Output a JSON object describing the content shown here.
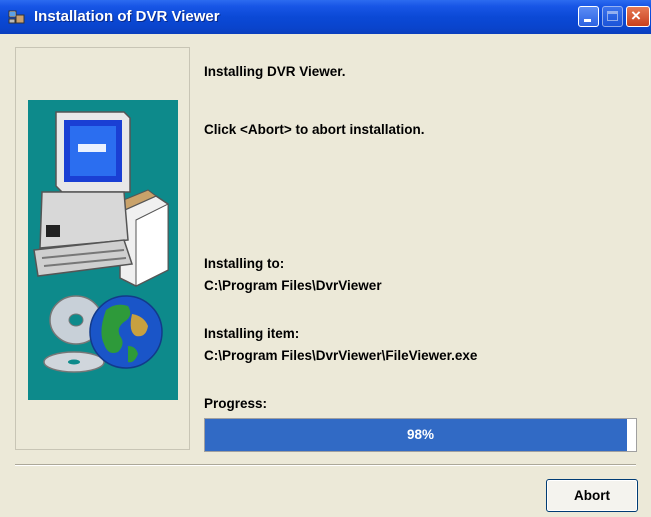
{
  "window": {
    "title": "Installation of DVR Viewer",
    "title_icon": "installer-icon"
  },
  "main": {
    "heading": "Installing DVR Viewer.",
    "instruction": "Click <Abort> to abort installation.",
    "install_to_label": "Installing to:",
    "install_to_path": "C:\\Program Files\\DvrViewer",
    "install_item_label": "Installing item:",
    "install_item_path": "C:\\Program Files\\DvrViewer\\FileViewer.exe",
    "progress_label": "Progress:",
    "progress_text": "98%",
    "progress_fraction": 0.98
  },
  "footer": {
    "abort_label": "Abort"
  },
  "colors": {
    "titlebar": "#0a49d6",
    "progress_fill": "#316ac5",
    "side_panel": "#0d8a8b"
  }
}
